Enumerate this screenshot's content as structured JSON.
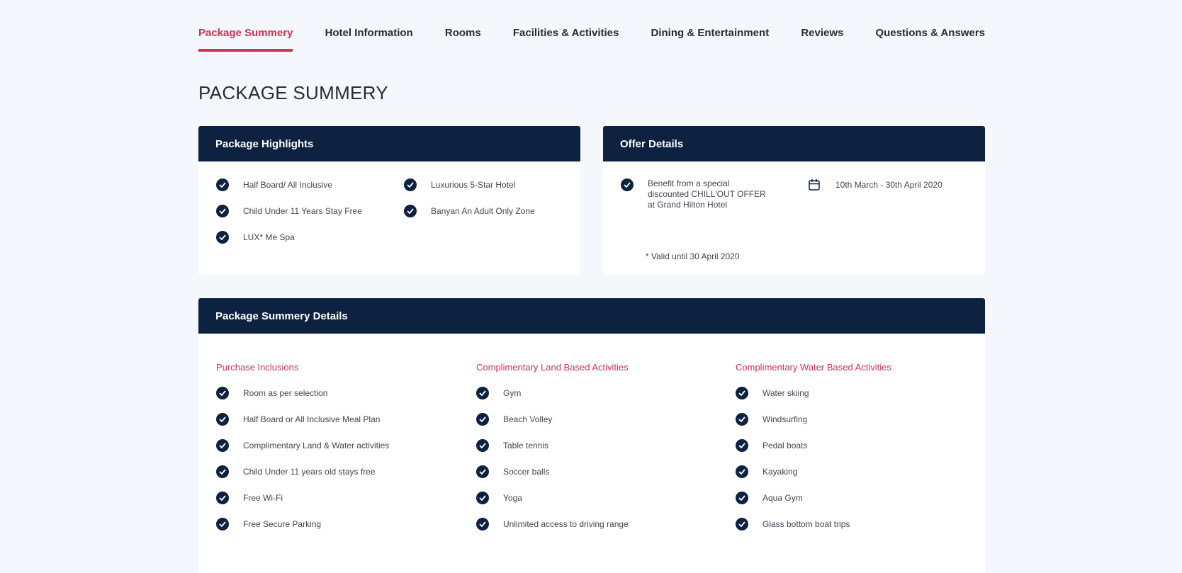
{
  "tabs": [
    {
      "label": "Package Summery"
    },
    {
      "label": "Hotel Information"
    },
    {
      "label": "Rooms"
    },
    {
      "label": "Facilities & Activities"
    },
    {
      "label": "Dining & Entertainment"
    },
    {
      "label": "Reviews"
    },
    {
      "label": "Questions & Answers"
    }
  ],
  "page_title": "PACKAGE SUMMERY",
  "highlights": {
    "title": "Package Highlights",
    "items": [
      "Half Board/ All Inclusive",
      "Luxurious 5-Star Hotel",
      "Child Under 11 Years Stay Free",
      "Banyan An Adult Only Zone",
      "LUX* Me Spa"
    ]
  },
  "offer": {
    "title": "Offer Details",
    "benefit": "Benefit from a special discounted CHILL'OUT OFFER at Grand Hilton Hotel",
    "dates": "10th March - 30th April 2020",
    "valid_note": "* Valid until 30 April 2020"
  },
  "details": {
    "title": "Package Summery Details",
    "columns": [
      {
        "heading": "Purchase Inclusions",
        "items": [
          "Room as per selection",
          "Half Board or All Inclusive Meal Plan",
          "Complimentary Land & Water activities",
          "Child Under 11 years old stays free",
          "Free Wi-Fi",
          "Free Secure Parking"
        ]
      },
      {
        "heading": "Complimentary Land Based Activities",
        "items": [
          "Gym",
          "Beach Volley",
          "Table tennis",
          "Soccer balls",
          "Yoga",
          "Unlimited access to driving range"
        ]
      },
      {
        "heading": "Complimentary Water Based Activities",
        "items": [
          "Water skiing",
          "Windsurfing",
          "Pedal boats",
          "Kayaking",
          "Aqua Gym",
          "Glass bottom boat trips"
        ]
      }
    ]
  },
  "icons": {
    "check": "check-circle-icon",
    "calendar": "calendar-icon"
  },
  "colors": {
    "accent": "#d0334d",
    "navy": "#0d2240",
    "background": "#f4f8fc"
  }
}
